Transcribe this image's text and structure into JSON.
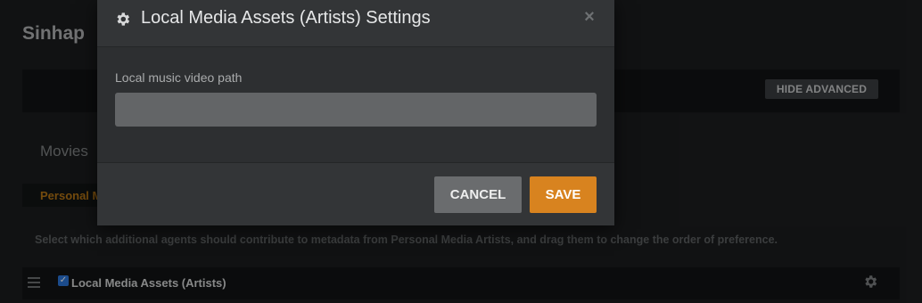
{
  "background": {
    "page_title": "Sinhap",
    "hide_advanced_label": "HIDE ADVANCED",
    "tab_movies": "Movies",
    "personal_tab": "Personal M",
    "description": "Select which additional agents should contribute to metadata from Personal Media Artists, and drag them to change the order of preference.",
    "agent_row": {
      "label": "Local Media Assets (Artists)",
      "checked": true,
      "checkbox_color": "#2a74d6"
    }
  },
  "modal": {
    "title": "Local Media Assets (Artists) Settings",
    "close_glyph": "×",
    "field_label": "Local music video path",
    "field_value": "",
    "cancel_label": "CANCEL",
    "save_label": "SAVE",
    "accent_color": "#d8831f"
  },
  "icons": {
    "modal_icon": "gear-icon",
    "close_icon": "close-icon",
    "row_handle": "drag-handle-icon",
    "row_settings": "gear-icon"
  }
}
